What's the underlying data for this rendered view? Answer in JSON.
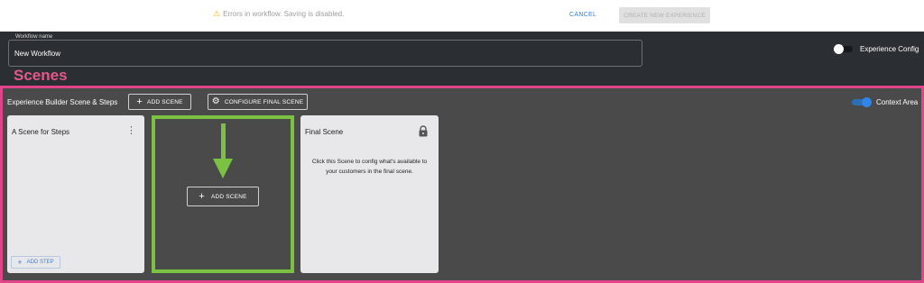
{
  "notice": {
    "icon": "warning-icon",
    "text": "Errors in workflow. Saving is disabled.",
    "cancel_label": "CANCEL",
    "create_label": "CREATE NEW EXPERIENCE"
  },
  "workflow": {
    "name_label": "Workflow name",
    "name_value": "New Workflow",
    "experience_config_label": "Experience Config",
    "experience_config_on": false
  },
  "scenes": {
    "heading": "Scenes",
    "builder_title": "Experience Builder Scene & Steps",
    "add_scene_label": "ADD SCENE",
    "configure_final_label": "CONFIGURE FINAL SCENE",
    "context_area_label": "Context Area",
    "context_area_on": true,
    "cards": [
      {
        "title": "A Scene for Steps",
        "add_step_label": "ADD STEP"
      },
      {
        "add_scene_label": "ADD SCENE"
      },
      {
        "title": "Final Scene",
        "description": "Click this Scene to config what's available to your customers in the final scene."
      }
    ]
  },
  "colors": {
    "accent_pink": "#e0458a",
    "highlight_green": "#7cc242",
    "link_blue": "#2f7fe0",
    "header_dark": "#2b2f33",
    "area_gray": "#4a4a4a"
  }
}
